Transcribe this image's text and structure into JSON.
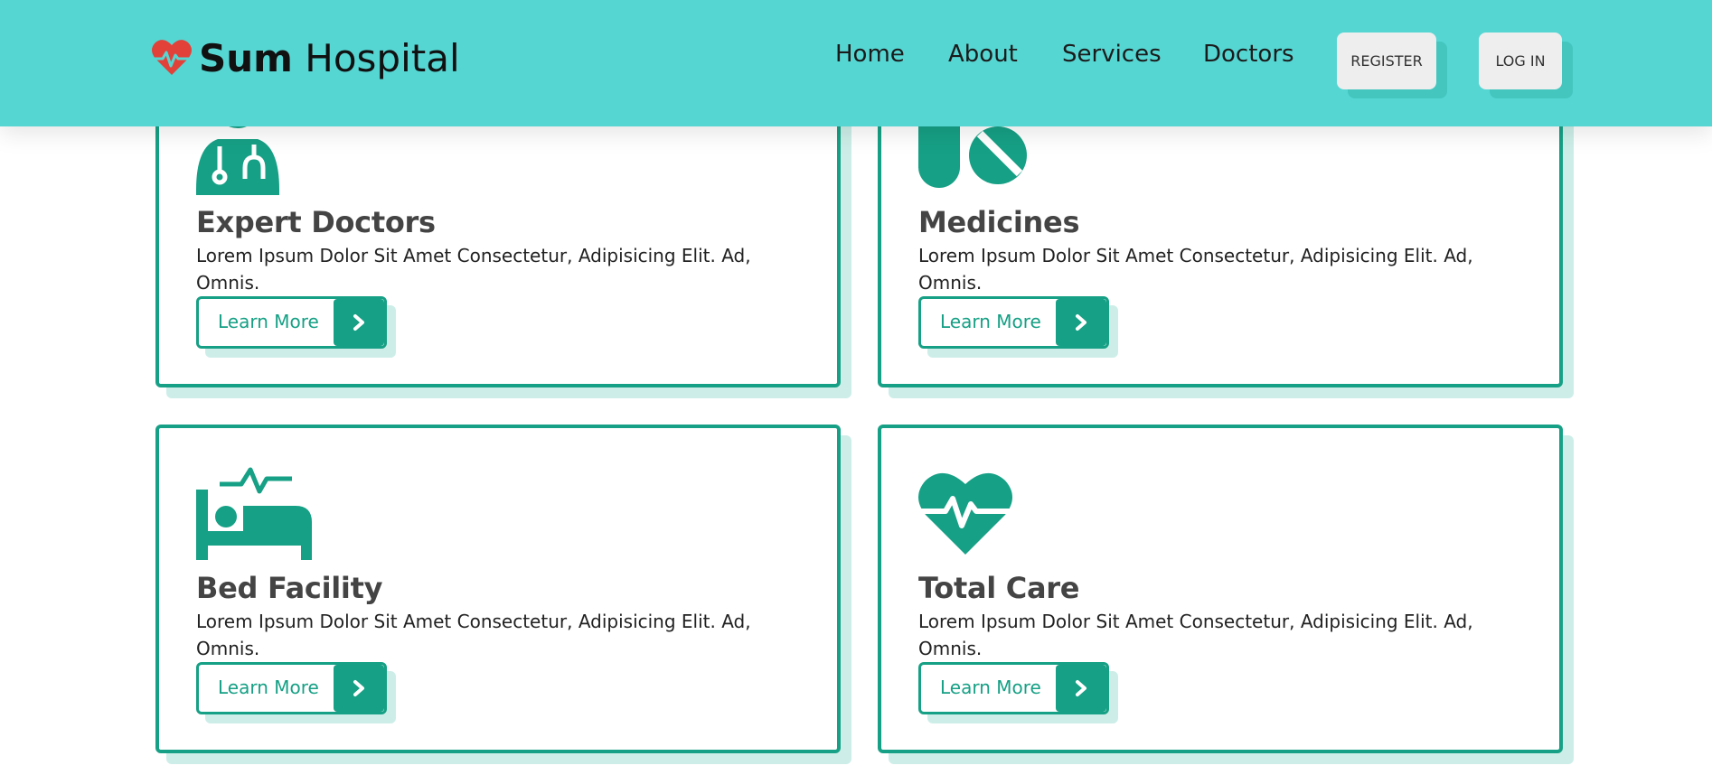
{
  "header": {
    "brand_bold": "Sum",
    "brand_regular": " Hospital",
    "nav": [
      {
        "label": "Home"
      },
      {
        "label": "About"
      },
      {
        "label": "Services"
      },
      {
        "label": "Doctors"
      }
    ],
    "register_label": "REGISTER",
    "login_label": "LOG IN"
  },
  "cards": [
    {
      "icon": "doctor-icon",
      "title": "Expert Doctors",
      "description": "Lorem Ipsum Dolor Sit Amet Consectetur, Adipisicing Elit. Ad, Omnis.",
      "button_label": "Learn More"
    },
    {
      "icon": "pills-icon",
      "title": "Medicines",
      "description": "Lorem Ipsum Dolor Sit Amet Consectetur, Adipisicing Elit. Ad, Omnis.",
      "button_label": "Learn More"
    },
    {
      "icon": "bed-icon",
      "title": "Bed Facility",
      "description": "Lorem Ipsum Dolor Sit Amet Consectetur, Adipisicing Elit. Ad, Omnis.",
      "button_label": "Learn More"
    },
    {
      "icon": "heart-pulse-icon",
      "title": "Total Care",
      "description": "Lorem Ipsum Dolor Sit Amet Consectetur, Adipisicing Elit. Ad, Omnis.",
      "button_label": "Learn More"
    }
  ],
  "colors": {
    "header_bg": "#55d6d3",
    "accent": "#16a085",
    "shadow": "#cdeee8",
    "logo_heart": "#e2413a",
    "heading": "#444444"
  }
}
